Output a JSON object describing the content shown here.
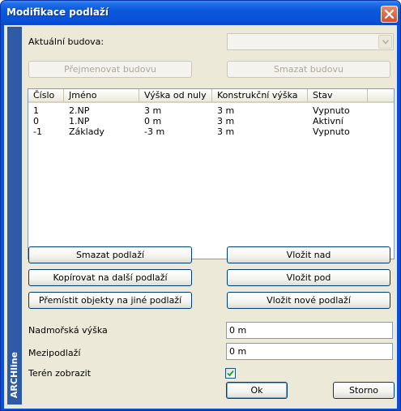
{
  "window": {
    "title": "Modifikace podlaží",
    "brand": "ARCHline"
  },
  "building": {
    "label": "Aktuální budova:",
    "value": "",
    "rename_label": "Přejmenovat budovu",
    "delete_label": "Smazat budovu"
  },
  "floors": {
    "columns": [
      "Číslo",
      "Jméno",
      "Výška od nuly",
      "Konstrukční výška",
      "Stav"
    ],
    "rows": [
      [
        "1",
        "2.NP",
        "3 m",
        "3 m",
        "Vypnuto"
      ],
      [
        "0",
        "1.NP",
        "0 m",
        "3 m",
        "Aktivní"
      ],
      [
        "-1",
        "Základy",
        "-3 m",
        "3 m",
        "Vypnuto"
      ]
    ]
  },
  "actions": {
    "delete_floor": "Smazat podlaží",
    "insert_above": "Vložit nad",
    "copy_next": "Kopírovat na další podlaží",
    "insert_below": "Vložit pod",
    "move_objects": "Přemístit objekty na jiné podlaží",
    "insert_new": "Vložit nové podlaží"
  },
  "settings": {
    "altitude_label": "Nadmořská výška",
    "altitude_value": "0 m",
    "mezzanine_label": "Mezipodlaží",
    "mezzanine_value": "0 m",
    "terrain_label": "Terén zobrazit",
    "terrain_checked": true
  },
  "footer": {
    "ok": "Ok",
    "cancel": "Storno"
  },
  "colors": {
    "titlebar": "#0a52d6",
    "brand_strip": "#2e5aa6",
    "dialog_bg": "#ece9d8"
  }
}
